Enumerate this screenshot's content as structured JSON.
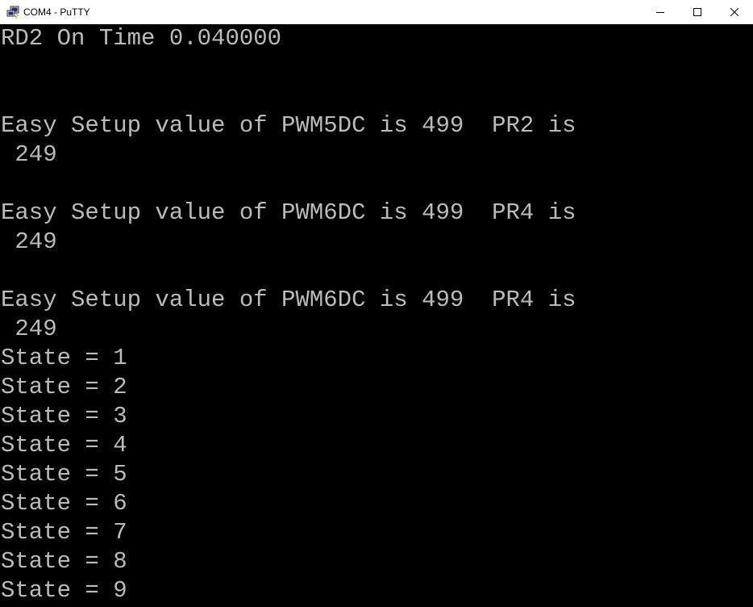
{
  "window": {
    "title": "COM4 - PuTTY",
    "icon": "putty-icon",
    "controls": {
      "minimize_icon": "minimize-icon",
      "maximize_icon": "maximize-icon",
      "close_icon": "close-icon"
    }
  },
  "terminal": {
    "colors": {
      "background": "#000000",
      "foreground": "#bbbbbb"
    },
    "lines": [
      "RD2 On Time 0.040000",
      "",
      "",
      "Easy Setup value of PWM5DC is 499  PR2 is",
      " 249",
      "",
      "Easy Setup value of PWM6DC is 499  PR4 is",
      " 249",
      "",
      "Easy Setup value of PWM6DC is 499  PR4 is",
      " 249",
      "State = 1",
      "State = 2",
      "State = 3",
      "State = 4",
      "State = 5",
      "State = 6",
      "State = 7",
      "State = 8",
      "State = 9"
    ]
  }
}
